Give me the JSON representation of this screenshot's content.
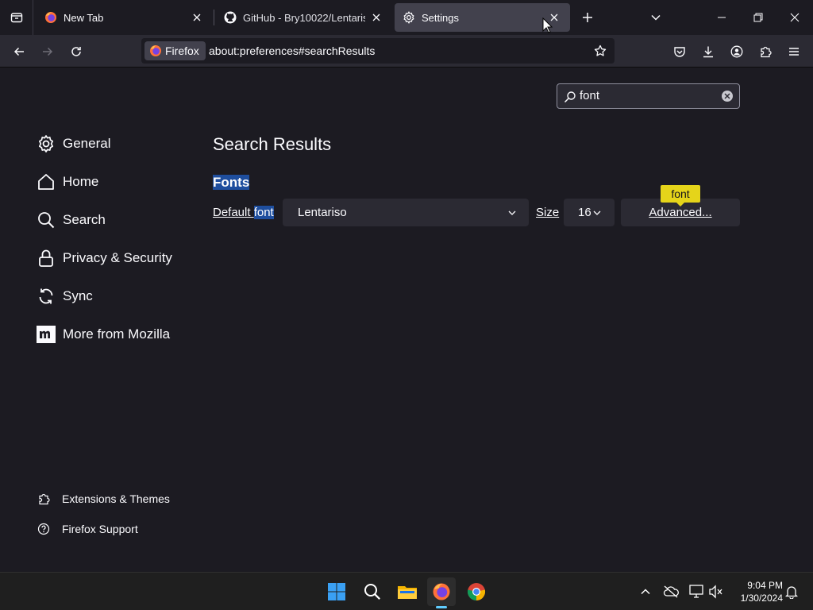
{
  "browser": {
    "tabs": [
      {
        "title": "New Tab",
        "favicon": "firefox-icon",
        "selected": false
      },
      {
        "title": "GitHub - Bry10022/Lentariso: Th",
        "favicon": "github-icon",
        "selected": false
      },
      {
        "title": "Settings",
        "favicon": "gear-icon",
        "selected": true
      }
    ],
    "identity_label": "Firefox",
    "url": "about:preferences#searchResults"
  },
  "settings": {
    "search": {
      "value": "font"
    },
    "categories": [
      {
        "label": "General",
        "icon": "gear-icon"
      },
      {
        "label": "Home",
        "icon": "home-icon"
      },
      {
        "label": "Search",
        "icon": "search-icon"
      },
      {
        "label": "Privacy & Security",
        "icon": "lock-icon"
      },
      {
        "label": "Sync",
        "icon": "sync-icon"
      },
      {
        "label": "More from Mozilla",
        "icon": "mozilla-icon"
      }
    ],
    "footer_links": [
      {
        "label": "Extensions & Themes",
        "icon": "puzzle-icon"
      },
      {
        "label": "Firefox Support",
        "icon": "help-icon"
      }
    ],
    "heading": "Search Results",
    "fonts": {
      "group_label": "Fonts",
      "default_font_label_prefix": "Default ",
      "default_font_label_match": "font",
      "default_font_value": "Lentariso",
      "size_label": "Size",
      "size_value": "16",
      "advanced_label": "Advanced...",
      "tooltip": "font"
    },
    "colors": {
      "highlight": "#1e4e9e",
      "tooltip": "#e5d41a"
    }
  },
  "taskbar": {
    "time": "9:04 PM",
    "date": "1/30/2024"
  }
}
